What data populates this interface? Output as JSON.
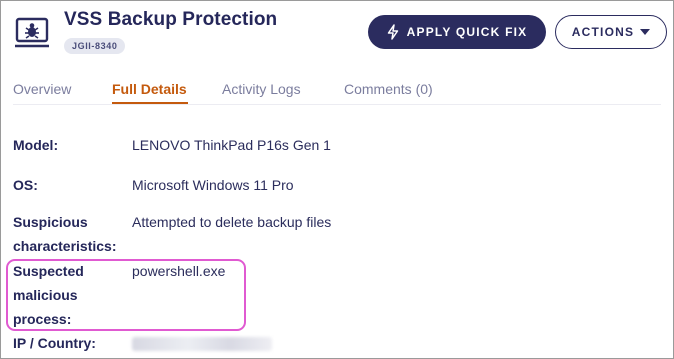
{
  "header": {
    "title": "VSS Backup Protection",
    "badge": "JGII-8340",
    "device_icon": "laptop-bug-icon"
  },
  "actions": {
    "quick_fix_label": "APPLY QUICK FIX",
    "quick_fix_icon": "lightning-icon",
    "actions_label": "ACTIONS",
    "actions_icon": "caret-down-icon"
  },
  "tabs": [
    {
      "label": "Overview",
      "active": false
    },
    {
      "label": "Full Details",
      "active": true
    },
    {
      "label": "Activity Logs",
      "active": false
    },
    {
      "label": "Comments (0)",
      "active": false
    }
  ],
  "details": {
    "model_label": "Model:",
    "model_value": "LENOVO ThinkPad P16s Gen 1",
    "os_label": "OS:",
    "os_value": "Microsoft Windows 11 Pro",
    "suspicious_label_line1": "Suspicious",
    "suspicious_label_line2": "characteristics:",
    "suspicious_value": "Attempted to delete backup files",
    "process_label_line1": "Suspected",
    "process_label_line2": "malicious",
    "process_label_line3": "process:",
    "process_value": "powershell.exe",
    "ip_label": "IP / Country:"
  },
  "colors": {
    "primary": "#2b2c5f",
    "active_tab": "#c45a0d",
    "highlight": "#e05ad1"
  }
}
